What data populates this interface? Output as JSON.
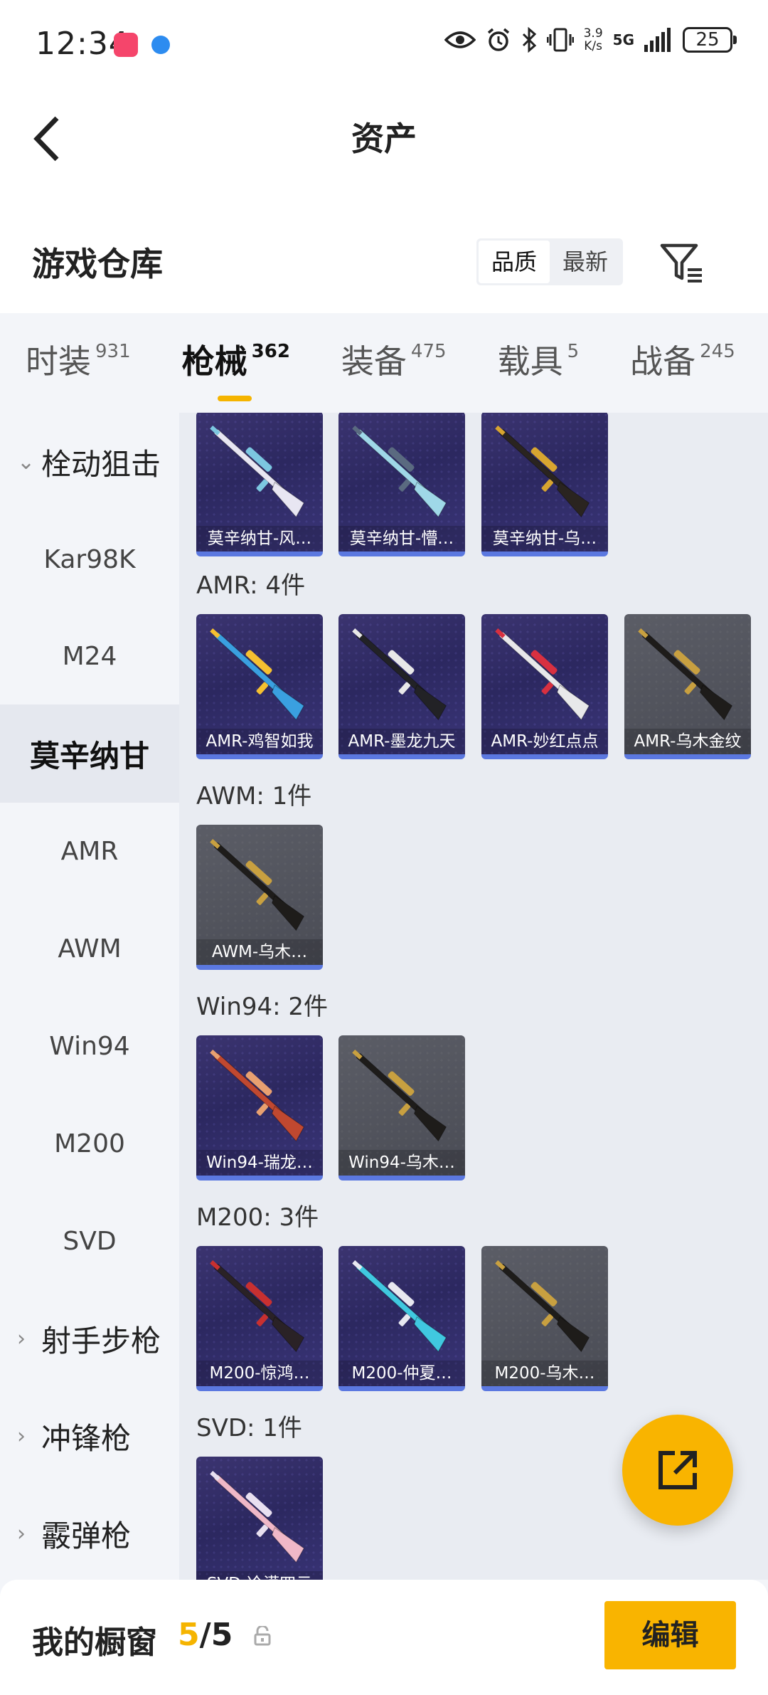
{
  "status_bar": {
    "time": "12:34",
    "net_speed_value": "3.9",
    "net_speed_unit": "K/s",
    "network": "5G",
    "battery": "25"
  },
  "header": {
    "title": "资产"
  },
  "warehouse": {
    "title": "游戏仓库",
    "sort_options": [
      "品质",
      "最新"
    ],
    "sort_selected": "品质"
  },
  "tabs": [
    {
      "label": "时装",
      "count": "931",
      "active": false
    },
    {
      "label": "枪械",
      "count": "362",
      "active": true
    },
    {
      "label": "装备",
      "count": "475",
      "active": false
    },
    {
      "label": "载具",
      "count": "5",
      "active": false
    },
    {
      "label": "战备",
      "count": "245",
      "active": false
    }
  ],
  "sidebar": [
    {
      "label": "栓动狙击",
      "type": "group",
      "chevron": "⌄"
    },
    {
      "label": "Kar98K",
      "type": "item"
    },
    {
      "label": "M24",
      "type": "item"
    },
    {
      "label": "莫辛纳甘",
      "type": "item",
      "selected": true
    },
    {
      "label": "AMR",
      "type": "item"
    },
    {
      "label": "AWM",
      "type": "item"
    },
    {
      "label": "Win94",
      "type": "item"
    },
    {
      "label": "M200",
      "type": "item"
    },
    {
      "label": "SVD",
      "type": "item"
    },
    {
      "label": "射手步枪",
      "type": "group",
      "chevron": "›"
    },
    {
      "label": "冲锋枪",
      "type": "group",
      "chevron": "›"
    },
    {
      "label": "霰弹枪",
      "type": "group",
      "chevron": "›"
    }
  ],
  "sections": [
    {
      "title": "",
      "items": [
        {
          "name": "莫辛纳甘-风…",
          "style": "purple",
          "gun_color": "#e8e6f2",
          "accent": "#7cc7e0"
        },
        {
          "name": "莫辛纳甘-懵…",
          "style": "purple",
          "gun_color": "#9fd8e8",
          "accent": "#5a6a80"
        },
        {
          "name": "莫辛纳甘-乌…",
          "style": "purple",
          "gun_color": "#2a2420",
          "accent": "#d8a530"
        }
      ]
    },
    {
      "title": "AMR: 4件",
      "items": [
        {
          "name": "AMR-鸡智如我",
          "style": "purple",
          "gun_color": "#3aa0e0",
          "accent": "#f5c030"
        },
        {
          "name": "AMR-墨龙九天",
          "style": "purple",
          "gun_color": "#222226",
          "accent": "#e8e8e8"
        },
        {
          "name": "AMR-妙红点点",
          "style": "purple",
          "gun_color": "#e8e8ea",
          "accent": "#d83040"
        },
        {
          "name": "AMR-乌木金纹",
          "style": "gray",
          "gun_color": "#1e1c1a",
          "accent": "#c8a040"
        }
      ]
    },
    {
      "title": "AWM: 1件",
      "items": [
        {
          "name": "AWM-乌木…",
          "style": "gray",
          "gun_color": "#1e1c1a",
          "accent": "#c8a040"
        }
      ]
    },
    {
      "title": "Win94: 2件",
      "items": [
        {
          "name": "Win94-瑞龙…",
          "style": "purple",
          "gun_color": "#c04830",
          "accent": "#e8a070"
        },
        {
          "name": "Win94-乌木…",
          "style": "gray",
          "gun_color": "#1e1c1a",
          "accent": "#c8a040"
        }
      ]
    },
    {
      "title": "M200: 3件",
      "items": [
        {
          "name": "M200-惊鸿…",
          "style": "purple",
          "gun_color": "#2a2226",
          "accent": "#c83030"
        },
        {
          "name": "M200-仲夏…",
          "style": "purple",
          "gun_color": "#40c8e0",
          "accent": "#e8e8f0"
        },
        {
          "name": "M200-乌木…",
          "style": "gray",
          "gun_color": "#1e1c1a",
          "accent": "#c8a040"
        }
      ]
    },
    {
      "title": "SVD: 1件",
      "items": [
        {
          "name": "SVD-冷漠四云",
          "style": "purple",
          "gun_color": "#f0b8c8",
          "accent": "#e8e0f0"
        }
      ]
    }
  ],
  "bottom": {
    "label": "我的橱窗",
    "count_current": "5",
    "count_sep": "/",
    "count_total": "5",
    "edit_label": "编辑"
  },
  "colors": {
    "accent": "#f9b400",
    "card_border": "#5b78e0"
  }
}
